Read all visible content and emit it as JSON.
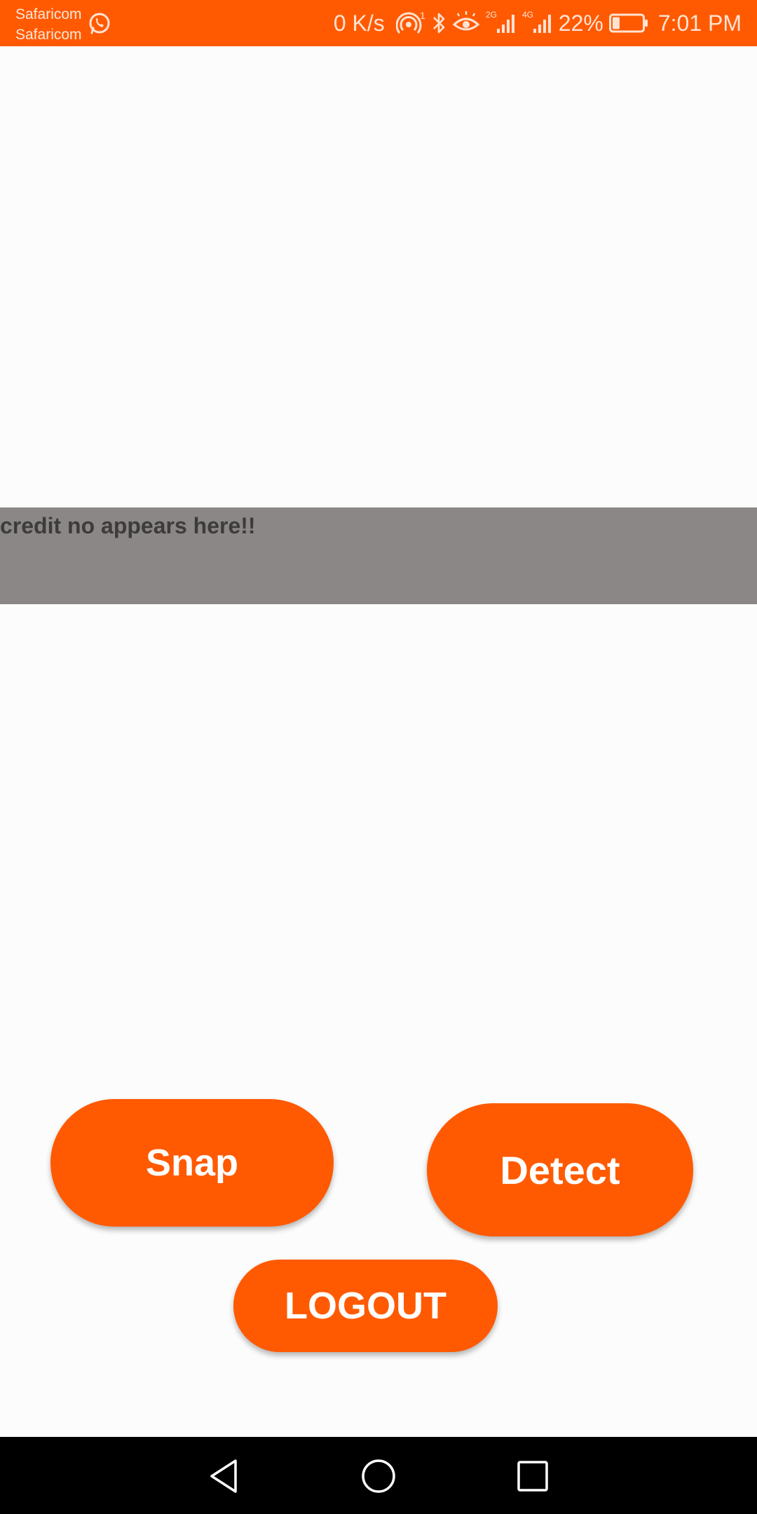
{
  "status_bar": {
    "carrier_1": "Safaricom",
    "carrier_2": "Safaricom",
    "network_speed": "0 K/s",
    "hotspot_badge": "1",
    "sim1_network": "2G",
    "sim2_network": "4G",
    "battery_percent": "22%",
    "battery_level": 0.22,
    "time": "7:01 PM",
    "background_color": "#ff5a02",
    "icons": [
      "whatsapp-icon",
      "hotspot-icon",
      "bluetooth-icon",
      "eye-comfort-icon",
      "signal-icon",
      "signal-icon",
      "battery-icon"
    ]
  },
  "credit_panel": {
    "text": "credit no appears here!!",
    "background_color": "#8a8786"
  },
  "buttons": {
    "snap_label": "Snap",
    "detect_label": "Detect",
    "logout_label": "LOGOUT",
    "color": "#ff5a02"
  },
  "nav_bar": {
    "icons": [
      "back-icon",
      "home-icon",
      "recents-icon"
    ]
  }
}
